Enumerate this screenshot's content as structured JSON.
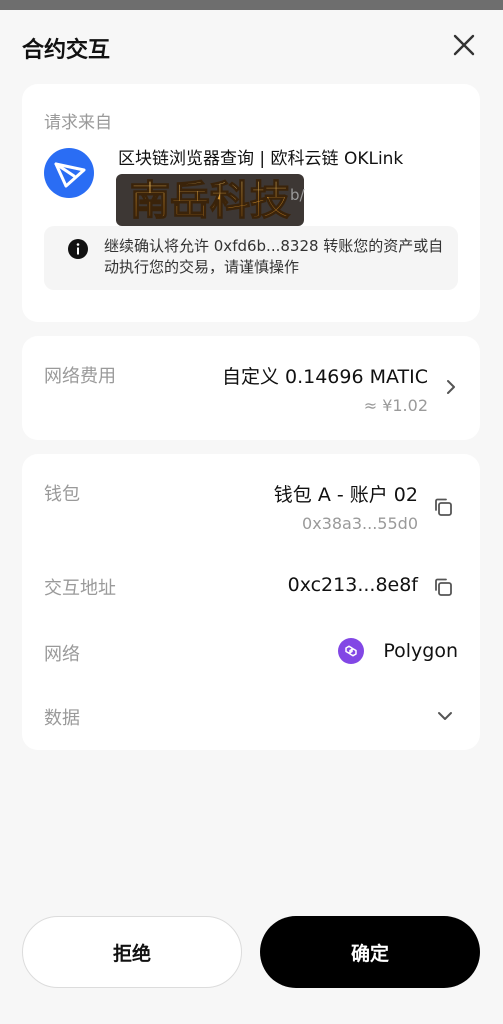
{
  "header": {
    "title": "合约交互",
    "close_icon": "close-icon"
  },
  "origin": {
    "label": "请求来自",
    "site_name": "区块链浏览器查询 | 欧科云链 OKLink",
    "site_url_fragment": "b/",
    "logo_icon": "oklink-logo-icon",
    "watermark_text": "南岳科技",
    "warning_text": "继续确认将允许 0xfd6b...8328 转账您的资产或自动执行您的交易，请谨慎操作",
    "warning_icon": "info-icon"
  },
  "fee": {
    "label": "网络费用",
    "value": "自定义 0.14696 MATIC",
    "fiat": "≈ ¥1.02"
  },
  "details": {
    "wallet_label": "钱包",
    "wallet_name": "钱包 A - 账户 02",
    "wallet_address": "0x38a3...55d0",
    "contract_label": "交互地址",
    "contract_address": "0xc213...8e8f",
    "network_label": "网络",
    "network_name": "Polygon",
    "data_label": "数据"
  },
  "actions": {
    "reject": "拒绝",
    "confirm": "确定"
  },
  "colors": {
    "background": "#f7f7f7",
    "card": "#ffffff",
    "muted": "#9a9a9a",
    "polygon": "#8247e5",
    "logo_blue": "#2a6df4",
    "confirm_bg": "#000000"
  }
}
